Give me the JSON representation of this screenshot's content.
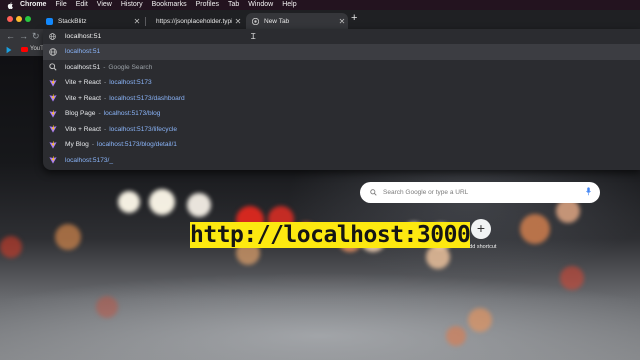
{
  "menubar": {
    "app": "Chrome",
    "items": [
      "File",
      "Edit",
      "View",
      "History",
      "Bookmarks",
      "Profiles",
      "Tab",
      "Window",
      "Help"
    ]
  },
  "tabs": [
    {
      "title": "StackBlitz",
      "favicon": "stackblitz-icon",
      "active": false
    },
    {
      "title": "https://jsonplaceholder.typicode.com",
      "favicon": "",
      "active": false
    },
    {
      "title": "New Tab",
      "favicon": "chrome-icon",
      "active": true
    }
  ],
  "bookmarks": {
    "youtube_label": "YouTu"
  },
  "omnibox": {
    "value": "localhost:51"
  },
  "suggestions": [
    {
      "icon": "globe-icon",
      "url": "localhost:51",
      "sep": "",
      "desc": "",
      "selected": true
    },
    {
      "icon": "search-icon",
      "url": "localhost:51",
      "sep": "-",
      "desc": "Google Search",
      "url_plain": true
    },
    {
      "icon": "vite-icon",
      "title": "Vite + React",
      "sep": "-",
      "url": "localhost:5173"
    },
    {
      "icon": "vite-icon",
      "title": "Vite + React",
      "sep": "-",
      "url": "localhost:5173/dashboard"
    },
    {
      "icon": "vite-icon",
      "title": "Blog Page",
      "sep": "-",
      "url": "localhost:5173/blog"
    },
    {
      "icon": "vite-icon",
      "title": "Vite + React",
      "sep": "-",
      "url": "localhost:5173/lifecycle"
    },
    {
      "icon": "vite-icon",
      "title": "My Blog",
      "sep": "-",
      "url": "localhost:5173/blog/detail/1"
    },
    {
      "icon": "vite-icon",
      "title": "",
      "sep": "",
      "url": "localhost:5173/_"
    }
  ],
  "newtab": {
    "search_placeholder": "Search Google or type a URL",
    "add_shortcut_label": "Add shortcut",
    "add_shortcut_symbol": "+"
  },
  "overlay": {
    "text": "http://localhost:3000"
  },
  "colors": {
    "overlay_bg": "#fde910",
    "link": "#8ab4f8",
    "menubar": "#23131f"
  }
}
